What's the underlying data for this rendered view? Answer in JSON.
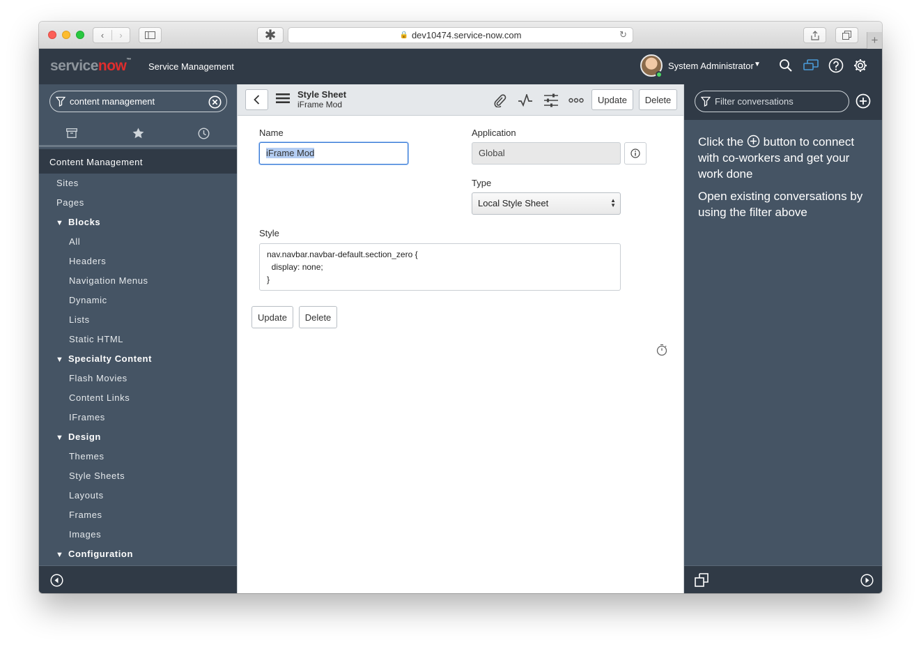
{
  "browser": {
    "url": "dev10474.service-now.com"
  },
  "header": {
    "logo_prefix": "service",
    "logo_suffix": "now",
    "logo_tm": "™",
    "app_title": "Service Management",
    "user_name": "System Administrator"
  },
  "nav": {
    "filter_value": "content management",
    "section_title": "Content Management",
    "items": [
      {
        "label": "Sites",
        "level": 1,
        "group": false
      },
      {
        "label": "Pages",
        "level": 1,
        "group": false
      },
      {
        "label": "Blocks",
        "level": 1,
        "group": true
      },
      {
        "label": "All",
        "level": 2,
        "group": false
      },
      {
        "label": "Headers",
        "level": 2,
        "group": false
      },
      {
        "label": "Navigation Menus",
        "level": 2,
        "group": false
      },
      {
        "label": "Dynamic",
        "level": 2,
        "group": false
      },
      {
        "label": "Lists",
        "level": 2,
        "group": false
      },
      {
        "label": "Static HTML",
        "level": 2,
        "group": false
      },
      {
        "label": "Specialty Content",
        "level": 1,
        "group": true
      },
      {
        "label": "Flash Movies",
        "level": 2,
        "group": false
      },
      {
        "label": "Content Links",
        "level": 2,
        "group": false
      },
      {
        "label": "IFrames",
        "level": 2,
        "group": false
      },
      {
        "label": "Design",
        "level": 1,
        "group": true
      },
      {
        "label": "Themes",
        "level": 2,
        "group": false
      },
      {
        "label": "Style Sheets",
        "level": 2,
        "group": false
      },
      {
        "label": "Layouts",
        "level": 2,
        "group": false
      },
      {
        "label": "Frames",
        "level": 2,
        "group": false
      },
      {
        "label": "Images",
        "level": 2,
        "group": false
      },
      {
        "label": "Configuration",
        "level": 1,
        "group": true
      }
    ]
  },
  "form": {
    "title": "Style Sheet",
    "subtitle": "iFrame Mod",
    "update_label": "Update",
    "delete_label": "Delete",
    "name_label": "Name",
    "name_value": "iFrame Mod",
    "application_label": "Application",
    "application_value": "Global",
    "type_label": "Type",
    "type_value": "Local Style Sheet",
    "style_label": "Style",
    "style_lines": [
      "nav.navbar.navbar-default.section_zero {",
      "  display: none;",
      "}"
    ]
  },
  "conversations": {
    "filter_placeholder": "Filter conversations",
    "msg_part1": "Click the",
    "msg_part2": "button to connect with co-workers and get your work done",
    "msg2": "Open existing conversations by using the filter above"
  },
  "colors": {
    "header_bg": "#303a46",
    "nav_bg": "#455464",
    "brand_red": "#e02d2d",
    "focus_blue": "#3a7bd5"
  }
}
